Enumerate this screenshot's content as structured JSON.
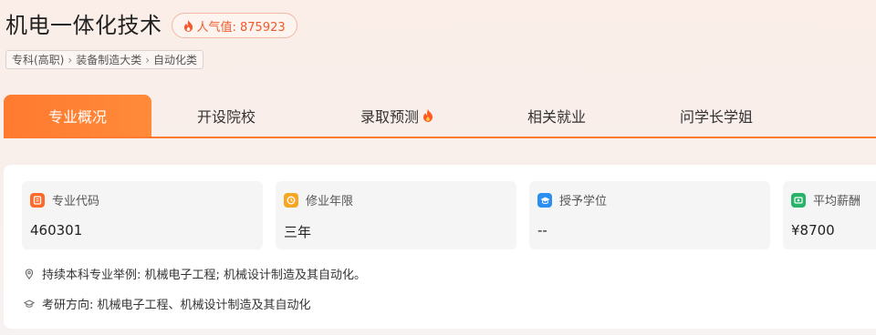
{
  "header": {
    "title": "机电一体化技术",
    "popularity_label": "人气值: 875923"
  },
  "breadcrumb": {
    "items": [
      "专科(高职)",
      "装备制造大类",
      "自动化类"
    ]
  },
  "tabs": [
    {
      "label": "专业概况",
      "active": true
    },
    {
      "label": "开设院校",
      "active": false
    },
    {
      "label": "录取预测",
      "active": false,
      "badge_icon": "fire-icon"
    },
    {
      "label": "相关就业",
      "active": false
    },
    {
      "label": "问学长学姐",
      "active": false
    }
  ],
  "info_boxes": [
    {
      "label": "专业代码",
      "value": "460301",
      "icon": "code-book-icon",
      "color": "#ff6a2a"
    },
    {
      "label": "修业年限",
      "value": "三年",
      "icon": "clock-icon",
      "color": "#f5a623"
    },
    {
      "label": "授予学位",
      "value": "--",
      "icon": "graduation-cap-icon",
      "color": "#2b8ef0"
    },
    {
      "label": "平均薪酬",
      "value": "¥8700",
      "icon": "money-icon",
      "color": "#27b36a"
    }
  ],
  "notes": {
    "undergrad": "持续本科专业举例: 机械电子工程; 机械设计制造及其自动化。",
    "postgrad": "考研方向: 机械电子工程、机械设计制造及其自动化"
  },
  "colors": {
    "accent": "#ff7a2f",
    "popularity": "#f25a2c"
  }
}
